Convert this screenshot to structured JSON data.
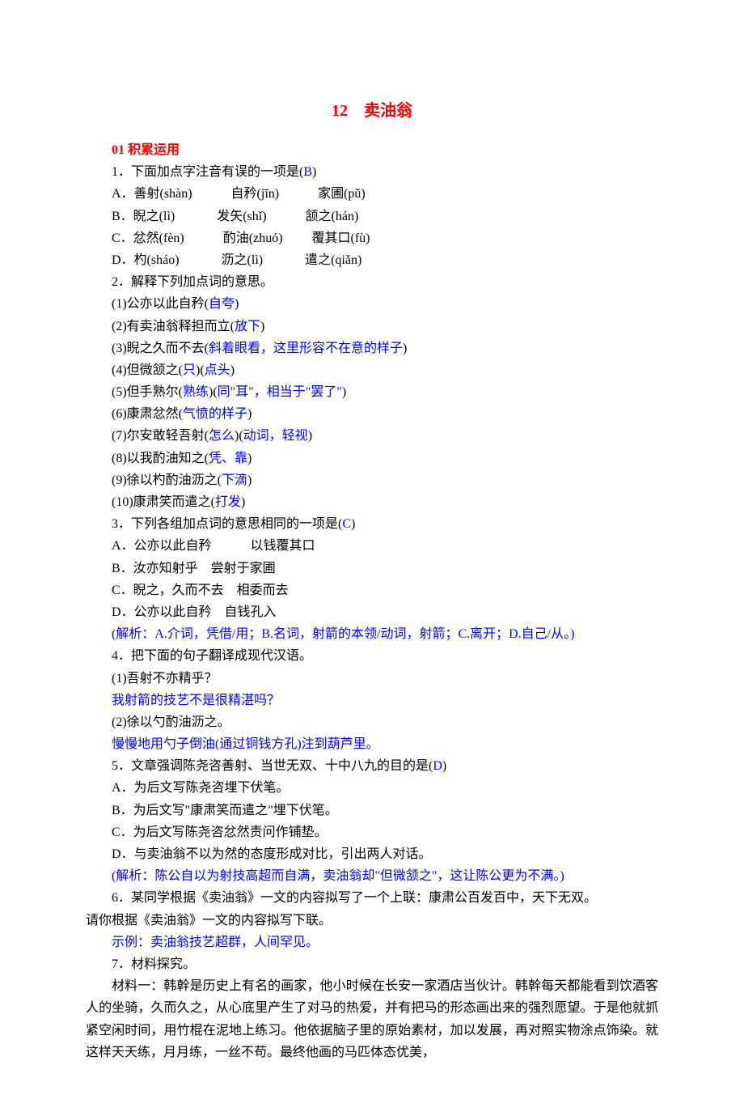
{
  "title": "12　卖油翁",
  "section1": "01 积累运用",
  "q1": {
    "stem_pre": "1．下面加点字注音有误的一项是(",
    "answer": "B",
    "stem_post": ")",
    "optA": "A．善射(shàn)　　　自矜(jīn)　　　家圃(pǔ)",
    "optB": "B．睨之(lì)　　　 发矢(shǐ)　　　颔之(hán)",
    "optC": "C．忿然(fèn)　　　酌油(zhuó)　　 覆其口(fù)",
    "optD": "D．杓(sháo)　　　 沥之(lì)　　　 遣之(qiǎn)"
  },
  "q2": {
    "stem": "2．解释下列加点词的意思。",
    "items": [
      {
        "pre": "(1)公亦以此自矜(",
        "ans": "自夸",
        "post": ")"
      },
      {
        "pre": "(2)有卖油翁释担而立(",
        "ans": "放下",
        "post": ")"
      },
      {
        "pre": "(3)睨之久而不去(",
        "ans": "斜着眼看，这里形容不在意的样子",
        "post": ")"
      },
      {
        "pre": "(4)但微颔之(",
        "ans1": "只",
        "mid": ")(",
        "ans2": "点头",
        "post": ")"
      },
      {
        "pre": "(5)但手熟尔(",
        "ans1": "熟练",
        "mid": ")(",
        "ans2": "同\"耳\"，相当于\"罢了\"",
        "post": ")"
      },
      {
        "pre": "(6)康肃忿然(",
        "ans": "气愤的样子",
        "post": ")"
      },
      {
        "pre": "(7)尔安敢轻吾射(",
        "ans1": "怎么",
        "mid": ")(",
        "ans2": "动词，轻视",
        "post": ")"
      },
      {
        "pre": "(8)以我酌油知之(",
        "ans": "凭、靠",
        "post": ")"
      },
      {
        "pre": "(9)徐以杓酌油沥之(",
        "ans": "下滴",
        "post": ")"
      },
      {
        "pre": "(10)康肃笑而遣之(",
        "ans": "打发",
        "post": ")"
      }
    ]
  },
  "q3": {
    "stem_pre": "3．下列各组加点词的意思相同的一项是(",
    "answer": "C",
    "stem_post": ")",
    "optA": "A．公亦以此自矜　　　以钱覆其口",
    "optB": "B．汝亦知射乎　尝射于家圃",
    "optC": "C．睨之，久而不去　相委而去",
    "optD": "D．公亦以此自矜　自钱孔入",
    "explain": "(解析：A.介词，凭借/用；B.名词，射箭的本领/动词，射箭；C.离开；D.自己/从。)"
  },
  "q4": {
    "stem": "4．把下面的句子翻译成现代汉语。",
    "i1_pre": "(1)吾射不亦精乎？",
    "i1_ans": "我射箭的技艺不是很精湛吗？",
    "i2_pre": "(2)徐以勺酌油沥之。",
    "i2_ans": "慢慢地用勺子倒油(通过铜钱方孔)注到葫芦里。"
  },
  "q5": {
    "stem_pre": "5．文章强调陈尧咨善射、当世无双、十中八九的目的是(",
    "answer": "D",
    "stem_post": ")",
    "optA": "A．为后文写陈尧咨埋下伏笔。",
    "optB": "B．为后文写\"康肃笑而遣之\"埋下伏笔。",
    "optC": "C．为后文写陈尧咨忿然责问作铺垫。",
    "optD": "D．与卖油翁不以为然的态度形成对比，引出两人对话。",
    "explain": "(解析：陈公自以为射技高超而自满，卖油翁却\"但微颔之\"，这让陈公更为不满。)"
  },
  "q6": {
    "line1": "6．某同学根据《卖油翁》一文的内容拟写了一个上联：康肃公百发百中，天下无双。",
    "line2": "请你根据《卖油翁》一文的内容拟写下联。",
    "ans": "示例：卖油翁技艺超群，人间罕见。"
  },
  "q7": {
    "stem": "7．材料探究。",
    "para": "材料一：韩幹是历史上有名的画家，他小时候在长安一家酒店当伙计。韩幹每天都能看到饮酒客人的坐骑，久而久之，从心底里产生了对马的热爱，并有把马的形态画出来的强烈愿望。于是他就抓紧空闲时间，用竹棍在泥地上练习。他依据脑子里的原始素材，加以发展，再对照实物涂点饰染。就这样天天练，月月练，一丝不苟。最终他画的马匹体态优美，"
  }
}
